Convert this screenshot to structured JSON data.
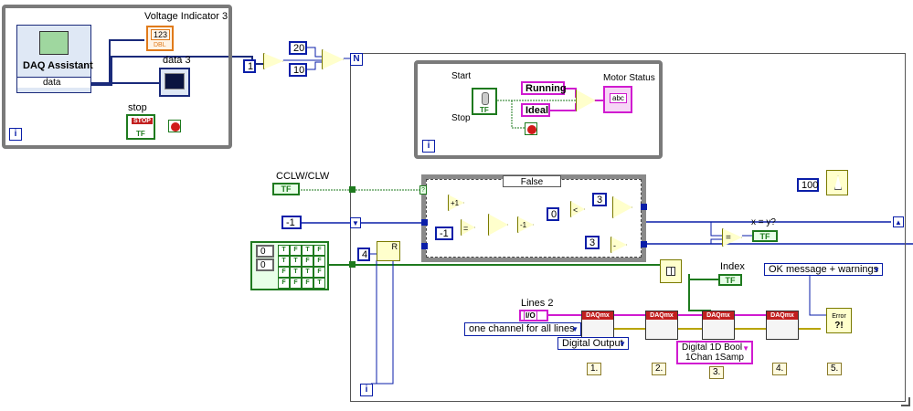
{
  "labels": {
    "voltage_indicator": "Voltage Indicator 3",
    "data3": "data 3",
    "daq_assistant": "DAQ Assistant",
    "daq_data": "data",
    "stop": "stop",
    "stop_button": "STOP",
    "tf": "TF",
    "start": "Start",
    "stop_lbl": "Stop",
    "motor_status": "Motor Status",
    "cclw": "CCLW/CLW",
    "index": "Index",
    "lines2": "Lines 2",
    "xy": "x = y?",
    "case_selector": "False",
    "num123": "123",
    "dbl": "DBL",
    "abc": "abc",
    "r": "R",
    "n": "N",
    "i": "i",
    "error": "Error"
  },
  "constants": {
    "c1": "1",
    "c20": "20",
    "c10": "10",
    "neg1_left": "-1",
    "neg1_case": "-1",
    "zero_case": "0",
    "three_top": "3",
    "three_bot": "3",
    "four": "4",
    "hundred": "100",
    "running": "Running",
    "ideal": "Ideal",
    "io": "I/O",
    "array_idx0": "0",
    "array_idx1": "0",
    "array_vals": [
      "T",
      "F",
      "T",
      "F",
      "T",
      "T",
      "F",
      "F",
      "F",
      "T",
      "T",
      "F",
      "F",
      "F",
      "F",
      "T"
    ],
    "plus1": "+1",
    "minus1": "-1",
    "eq": "=",
    "lt": "<",
    "minus": "-"
  },
  "rings": {
    "channels": "one channel for all lines",
    "digital_output": "Digital Output",
    "digital_bool_l1": "Digital 1D Bool",
    "digital_bool_l2": "1Chan 1Samp",
    "ok_message": "OK message + warnings"
  },
  "steps": [
    "1.",
    "2.",
    "3.",
    "4.",
    "5."
  ],
  "daqmx": {
    "header": "DAQmx"
  }
}
